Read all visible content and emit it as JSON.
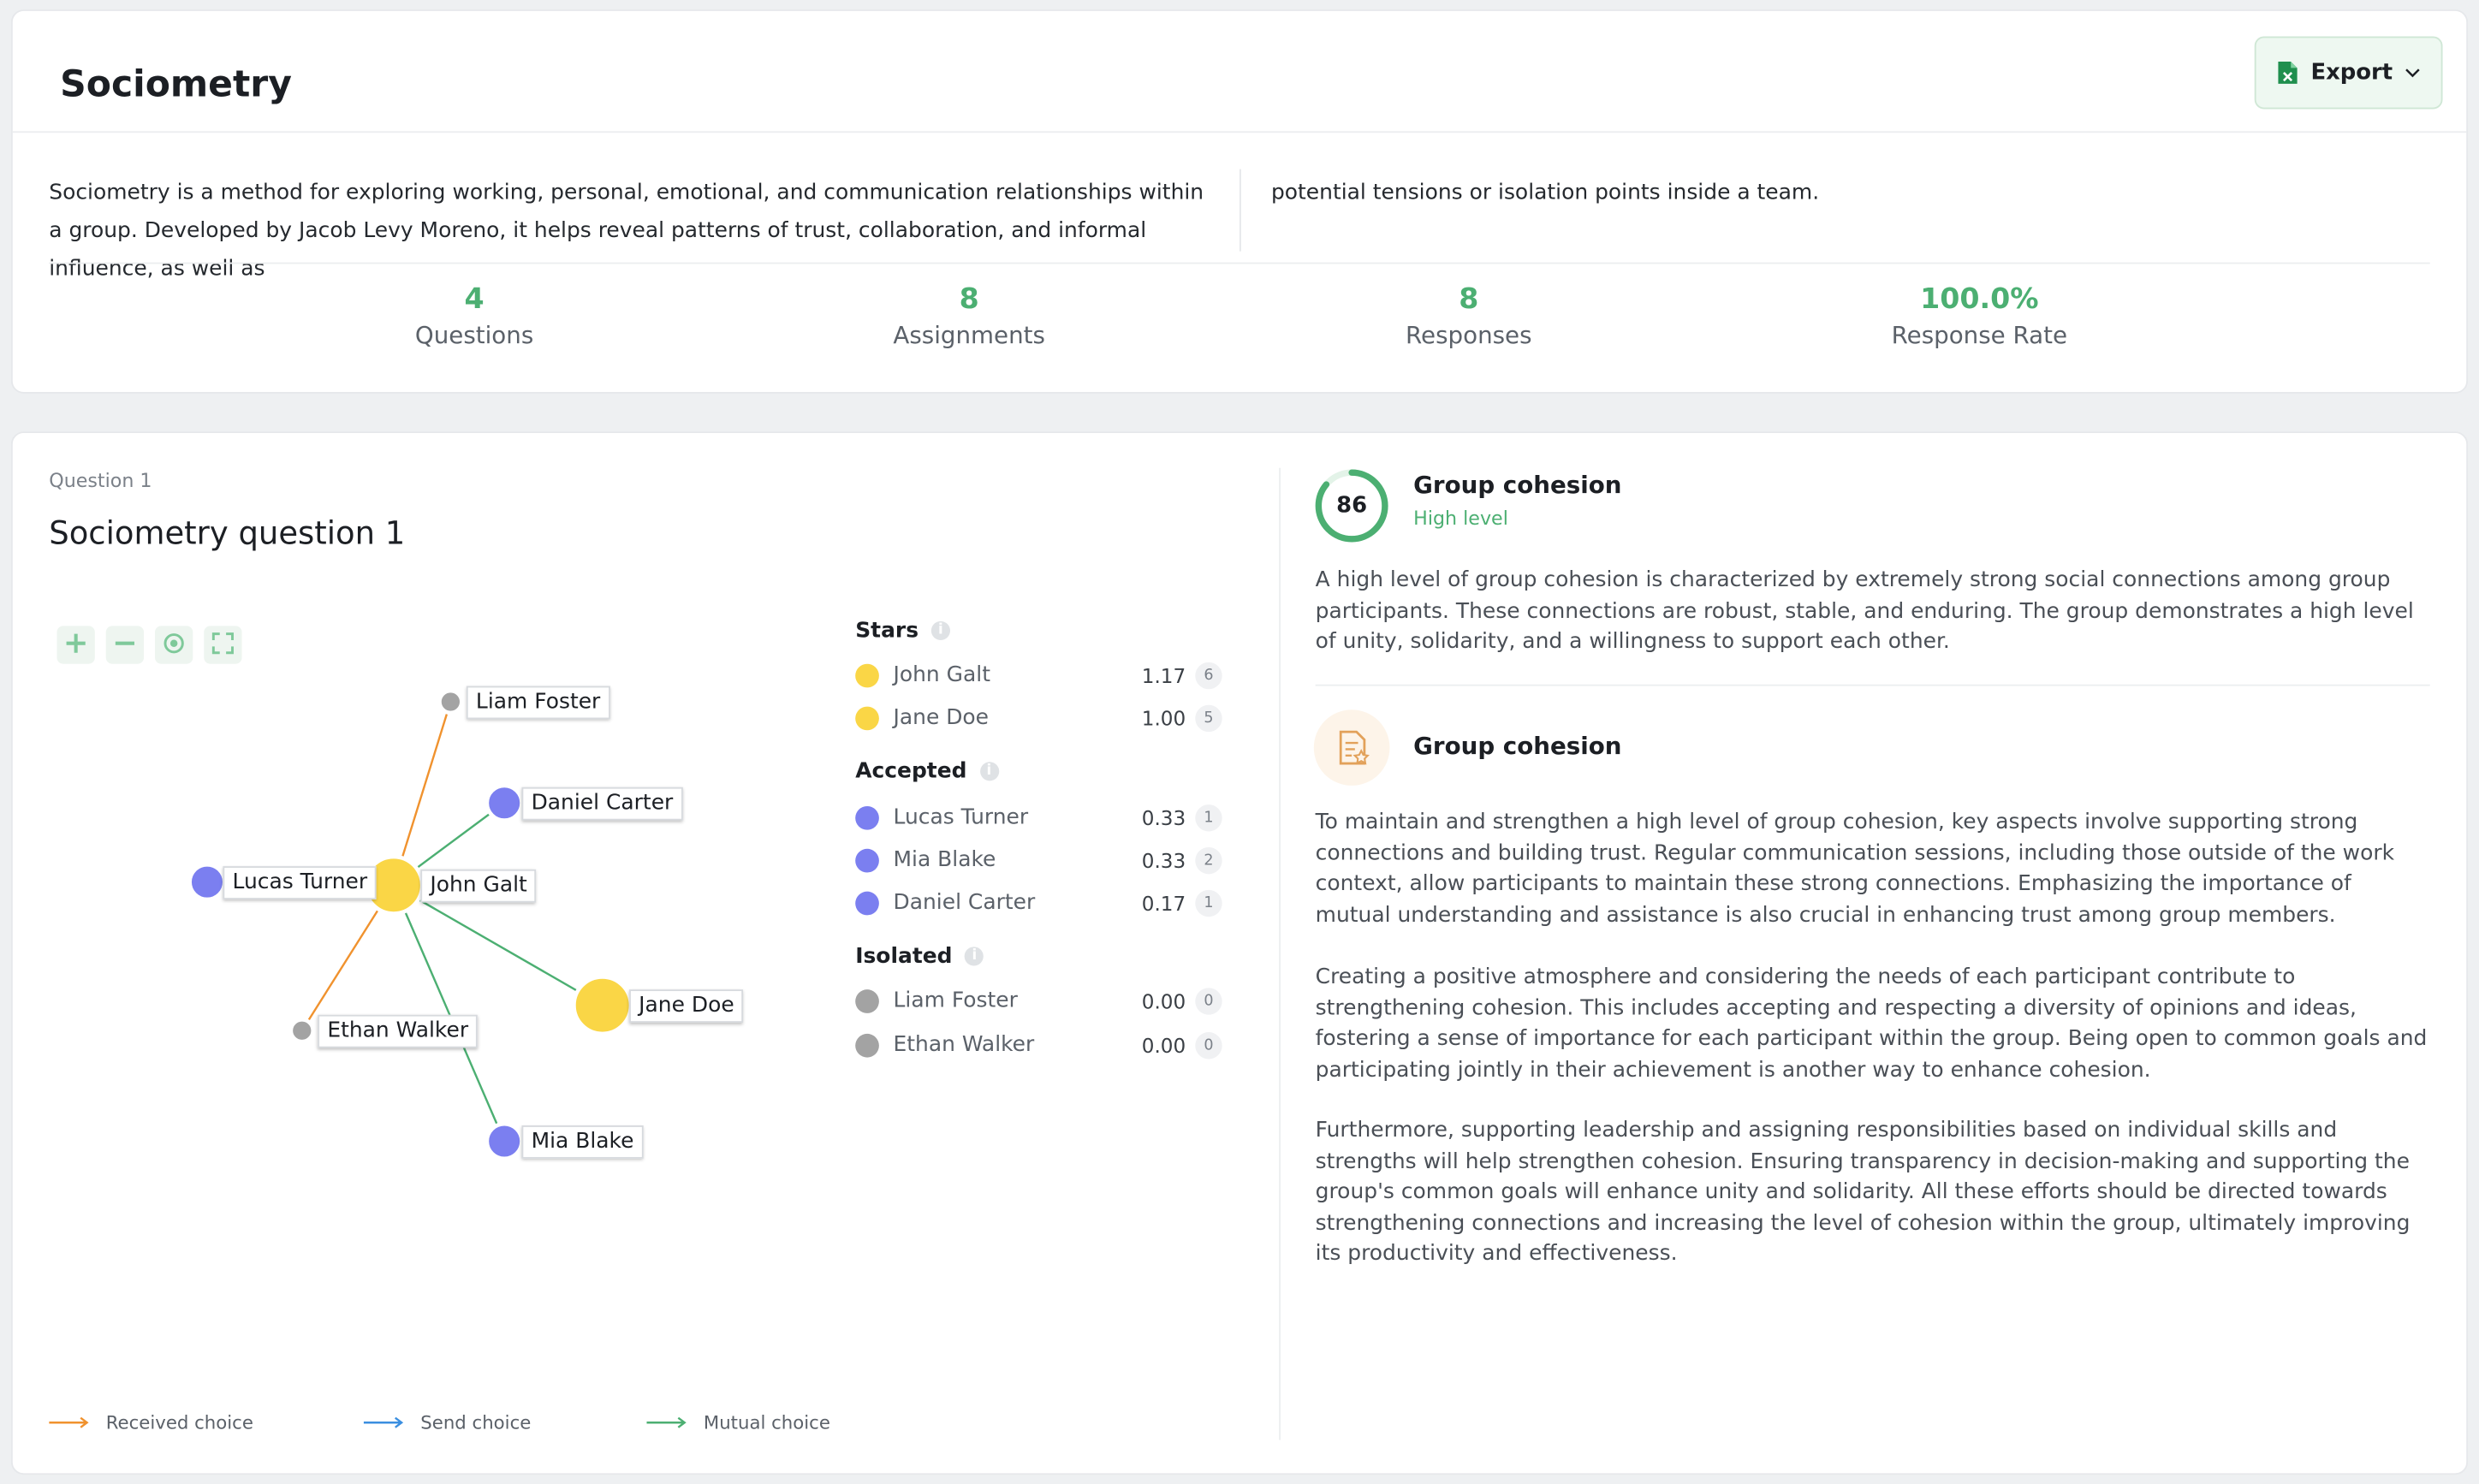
{
  "header": {
    "title": "Sociometry",
    "export_label": "Export"
  },
  "description": {
    "left": "Sociometry is a method for exploring working, personal, emotional, and communication relationships within a group. Developed by Jacob Levy Moreno, it helps reveal patterns of trust, collaboration, and informal influence, as well as",
    "right": "potential tensions or isolation points inside a team."
  },
  "stats": [
    {
      "value": "4",
      "label": "Questions"
    },
    {
      "value": "8",
      "label": "Assignments"
    },
    {
      "value": "8",
      "label": "Responses"
    },
    {
      "value": "100.0%",
      "label": "Response Rate"
    }
  ],
  "question": {
    "label": "Question 1",
    "title": "Sociometry question 1"
  },
  "graph": {
    "nodes": [
      {
        "name": "Liam Foster",
        "group": "isolated"
      },
      {
        "name": "Daniel Carter",
        "group": "accepted"
      },
      {
        "name": "Lucas Turner",
        "group": "accepted"
      },
      {
        "name": "John Galt",
        "group": "stars"
      },
      {
        "name": "Jane Doe",
        "group": "stars"
      },
      {
        "name": "Ethan Walker",
        "group": "isolated"
      },
      {
        "name": "Mia Blake",
        "group": "accepted"
      }
    ],
    "edges": [
      {
        "from": "John Galt",
        "to": "Liam Foster",
        "type": "received"
      },
      {
        "from": "John Galt",
        "to": "Ethan Walker",
        "type": "received"
      },
      {
        "from": "John Galt",
        "to": "Daniel Carter",
        "type": "mutual"
      },
      {
        "from": "John Galt",
        "to": "Jane Doe",
        "type": "mutual"
      },
      {
        "from": "John Galt",
        "to": "Mia Blake",
        "type": "mutual"
      },
      {
        "from": "John Galt",
        "to": "Lucas Turner",
        "type": "mutual"
      }
    ]
  },
  "legend": [
    {
      "label": "Received choice",
      "color": "#f0922e"
    },
    {
      "label": "Send choice",
      "color": "#3b8fe0"
    },
    {
      "label": "Mutual choice",
      "color": "#4caf72"
    }
  ],
  "groups": [
    {
      "title": "Stars",
      "color": "#fad646",
      "people": [
        {
          "name": "John Galt",
          "score": "1.17",
          "count": "6"
        },
        {
          "name": "Jane Doe",
          "score": "1.00",
          "count": "5"
        }
      ]
    },
    {
      "title": "Accepted",
      "color": "#7b7ff0",
      "people": [
        {
          "name": "Lucas Turner",
          "score": "0.33",
          "count": "1"
        },
        {
          "name": "Mia Blake",
          "score": "0.33",
          "count": "2"
        },
        {
          "name": "Daniel Carter",
          "score": "0.17",
          "count": "1"
        }
      ]
    },
    {
      "title": "Isolated",
      "color": "#a3a3a3",
      "people": [
        {
          "name": "Liam Foster",
          "score": "0.00",
          "count": "0"
        },
        {
          "name": "Ethan Walker",
          "score": "0.00",
          "count": "0"
        }
      ]
    }
  ],
  "cohesion": {
    "score": "86",
    "score_fraction": 0.86,
    "title": "Group cohesion",
    "level": "High level",
    "description": "A high level of group cohesion is characterized by extremely strong social connections among group participants. These connections are robust, stable, and enduring. The group demonstrates a high level of unity, solidarity, and a willingness to support each other.",
    "accent_color": "#4caf72"
  },
  "recommendation": {
    "title": "Group cohesion",
    "paragraphs": [
      "To maintain and strengthen a high level of group cohesion, key aspects involve supporting strong connections and building trust. Regular communication sessions, including those outside of the work context, allow participants to maintain these strong connections. Emphasizing the importance of mutual understanding and assistance is also crucial in enhancing trust among group members.",
      "Creating a positive atmosphere and considering the needs of each participant contribute to strengthening cohesion. This includes accepting and respecting a diversity of opinions and ideas, fostering a sense of importance for each participant within the group. Being open to common goals and participating jointly in their achievement is another way to enhance cohesion.",
      "Furthermore, supporting leadership and assigning responsibilities based on individual skills and strengths will help strengthen cohesion. Ensuring transparency in decision-making and supporting the group's common goals will enhance unity and solidarity. All these efforts should be directed towards strengthening connections and increasing the level of cohesion within the group, ultimately improving its productivity and effectiveness."
    ]
  }
}
